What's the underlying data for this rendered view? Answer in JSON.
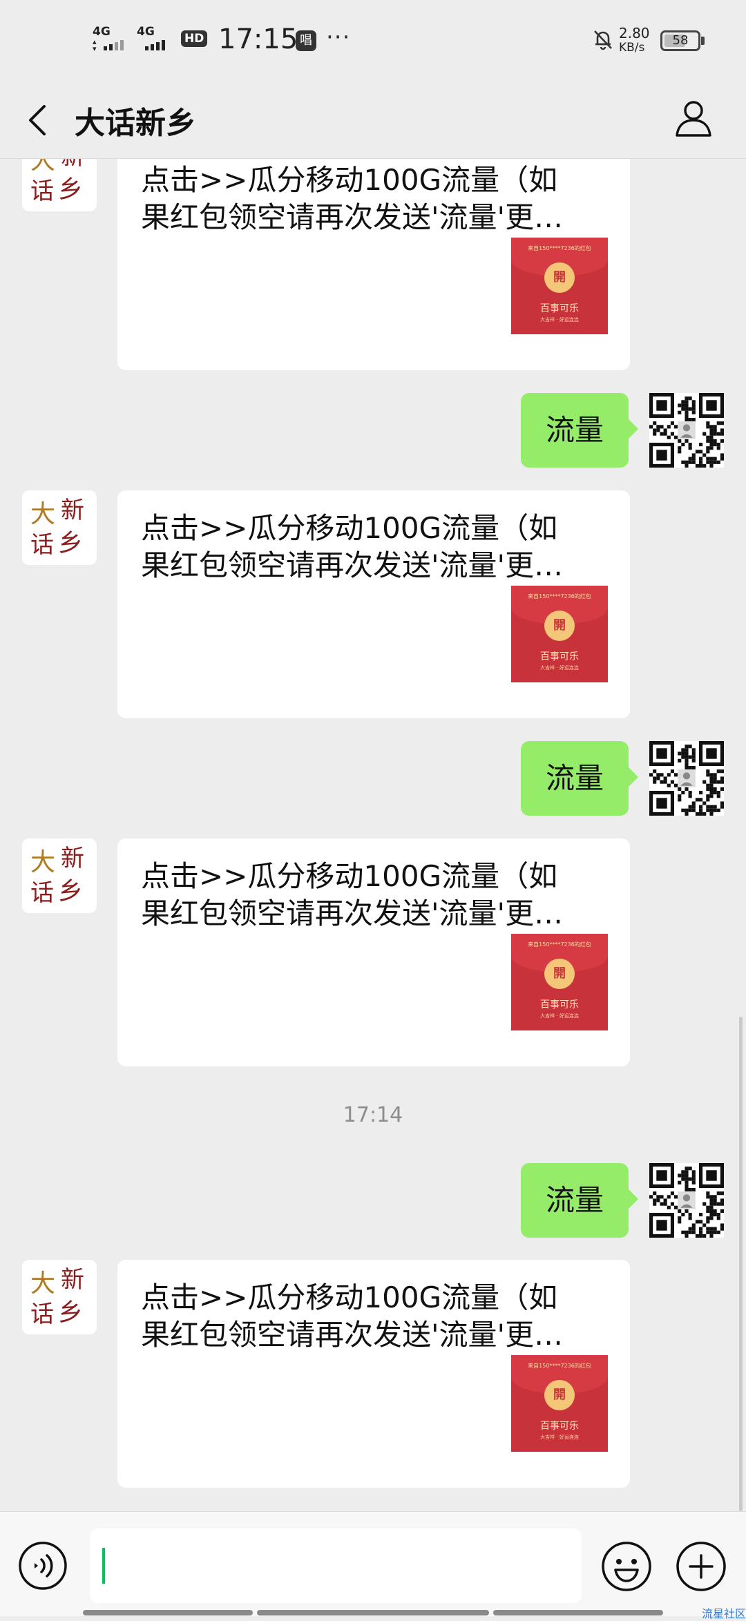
{
  "status_bar": {
    "network1": "4G",
    "network2": "4G",
    "hd": "HD",
    "time": "17:15",
    "app_icon": "唱",
    "more": "···",
    "speed_value": "2.80",
    "speed_unit": "KB/s",
    "battery": "58"
  },
  "nav": {
    "title": "大话新乡",
    "icons": {
      "back": "chevron-left-icon",
      "profile": "person-icon"
    }
  },
  "chat": {
    "card_line1": "点击>>瓜分移动100G流量（如",
    "card_line2": "果红包领空请再次发送'流量'更…",
    "red_packet": {
      "header": "来自150****7236的红包",
      "coin": "開",
      "title": "百事可乐",
      "sub": "大吉祥 · 好运连连"
    },
    "sent_text": "流量",
    "timestamp": "17:14",
    "avatar_chars": [
      "大",
      "新",
      "话",
      "乡"
    ]
  },
  "input_bar": {
    "icons": {
      "voice": "voice-icon",
      "emoji": "emoji-icon",
      "plus": "plus-icon"
    },
    "watermark": "流星社区"
  },
  "colors": {
    "background": "#ededed",
    "sent_bubble": "#95ec69",
    "accent": "#07c160",
    "red_packet": "#c8323a"
  }
}
